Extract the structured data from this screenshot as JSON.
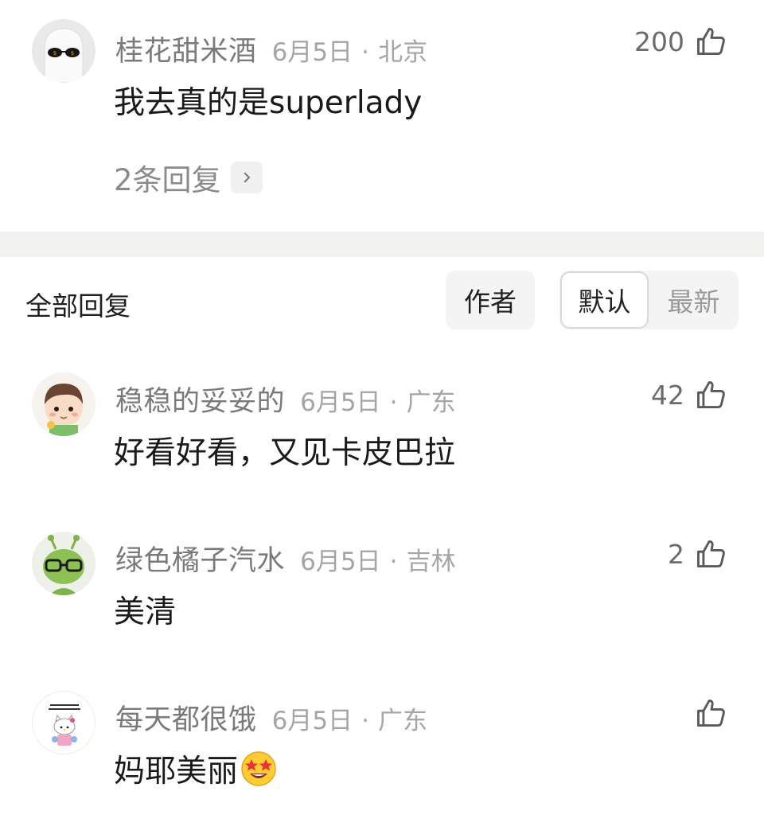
{
  "top_comment": {
    "username": "桂花甜米酒",
    "date": "6月5日",
    "separator": "·",
    "location": "北京",
    "like_count": "200",
    "text": "我去真的是superlady",
    "replies_label": "2条回复",
    "avatar_icon": "ghost-sunglasses-avatar"
  },
  "sort_bar": {
    "title": "全部回复",
    "author_tab": "作者",
    "default_tab": "默认",
    "newest_tab": "最新",
    "active": "默认"
  },
  "replies": [
    {
      "username": "稳稳的妥妥的",
      "date": "6月5日",
      "separator": "·",
      "location": "广东",
      "like_count": "42",
      "text": "好看好看，又见卡皮巴拉",
      "avatar_icon": "cartoon-boy-avatar"
    },
    {
      "username": "绿色橘子汽水",
      "date": "6月5日",
      "separator": "·",
      "location": "吉林",
      "like_count": "2",
      "text": "美清",
      "avatar_icon": "green-alien-glasses-avatar"
    },
    {
      "username": "每天都很饿",
      "date": "6月5日",
      "separator": "·",
      "location": "广东",
      "like_count": "",
      "text": "妈耶美丽",
      "emoji": "star-struck-emoji",
      "avatar_icon": "hello-kitty-avatar"
    }
  ],
  "colors": {
    "username": "#7a7a7a",
    "meta": "#a5a5a5",
    "body_text": "#1a1a1a",
    "divider": "#f1f1ef",
    "segment_bg": "#f4f4f4"
  }
}
